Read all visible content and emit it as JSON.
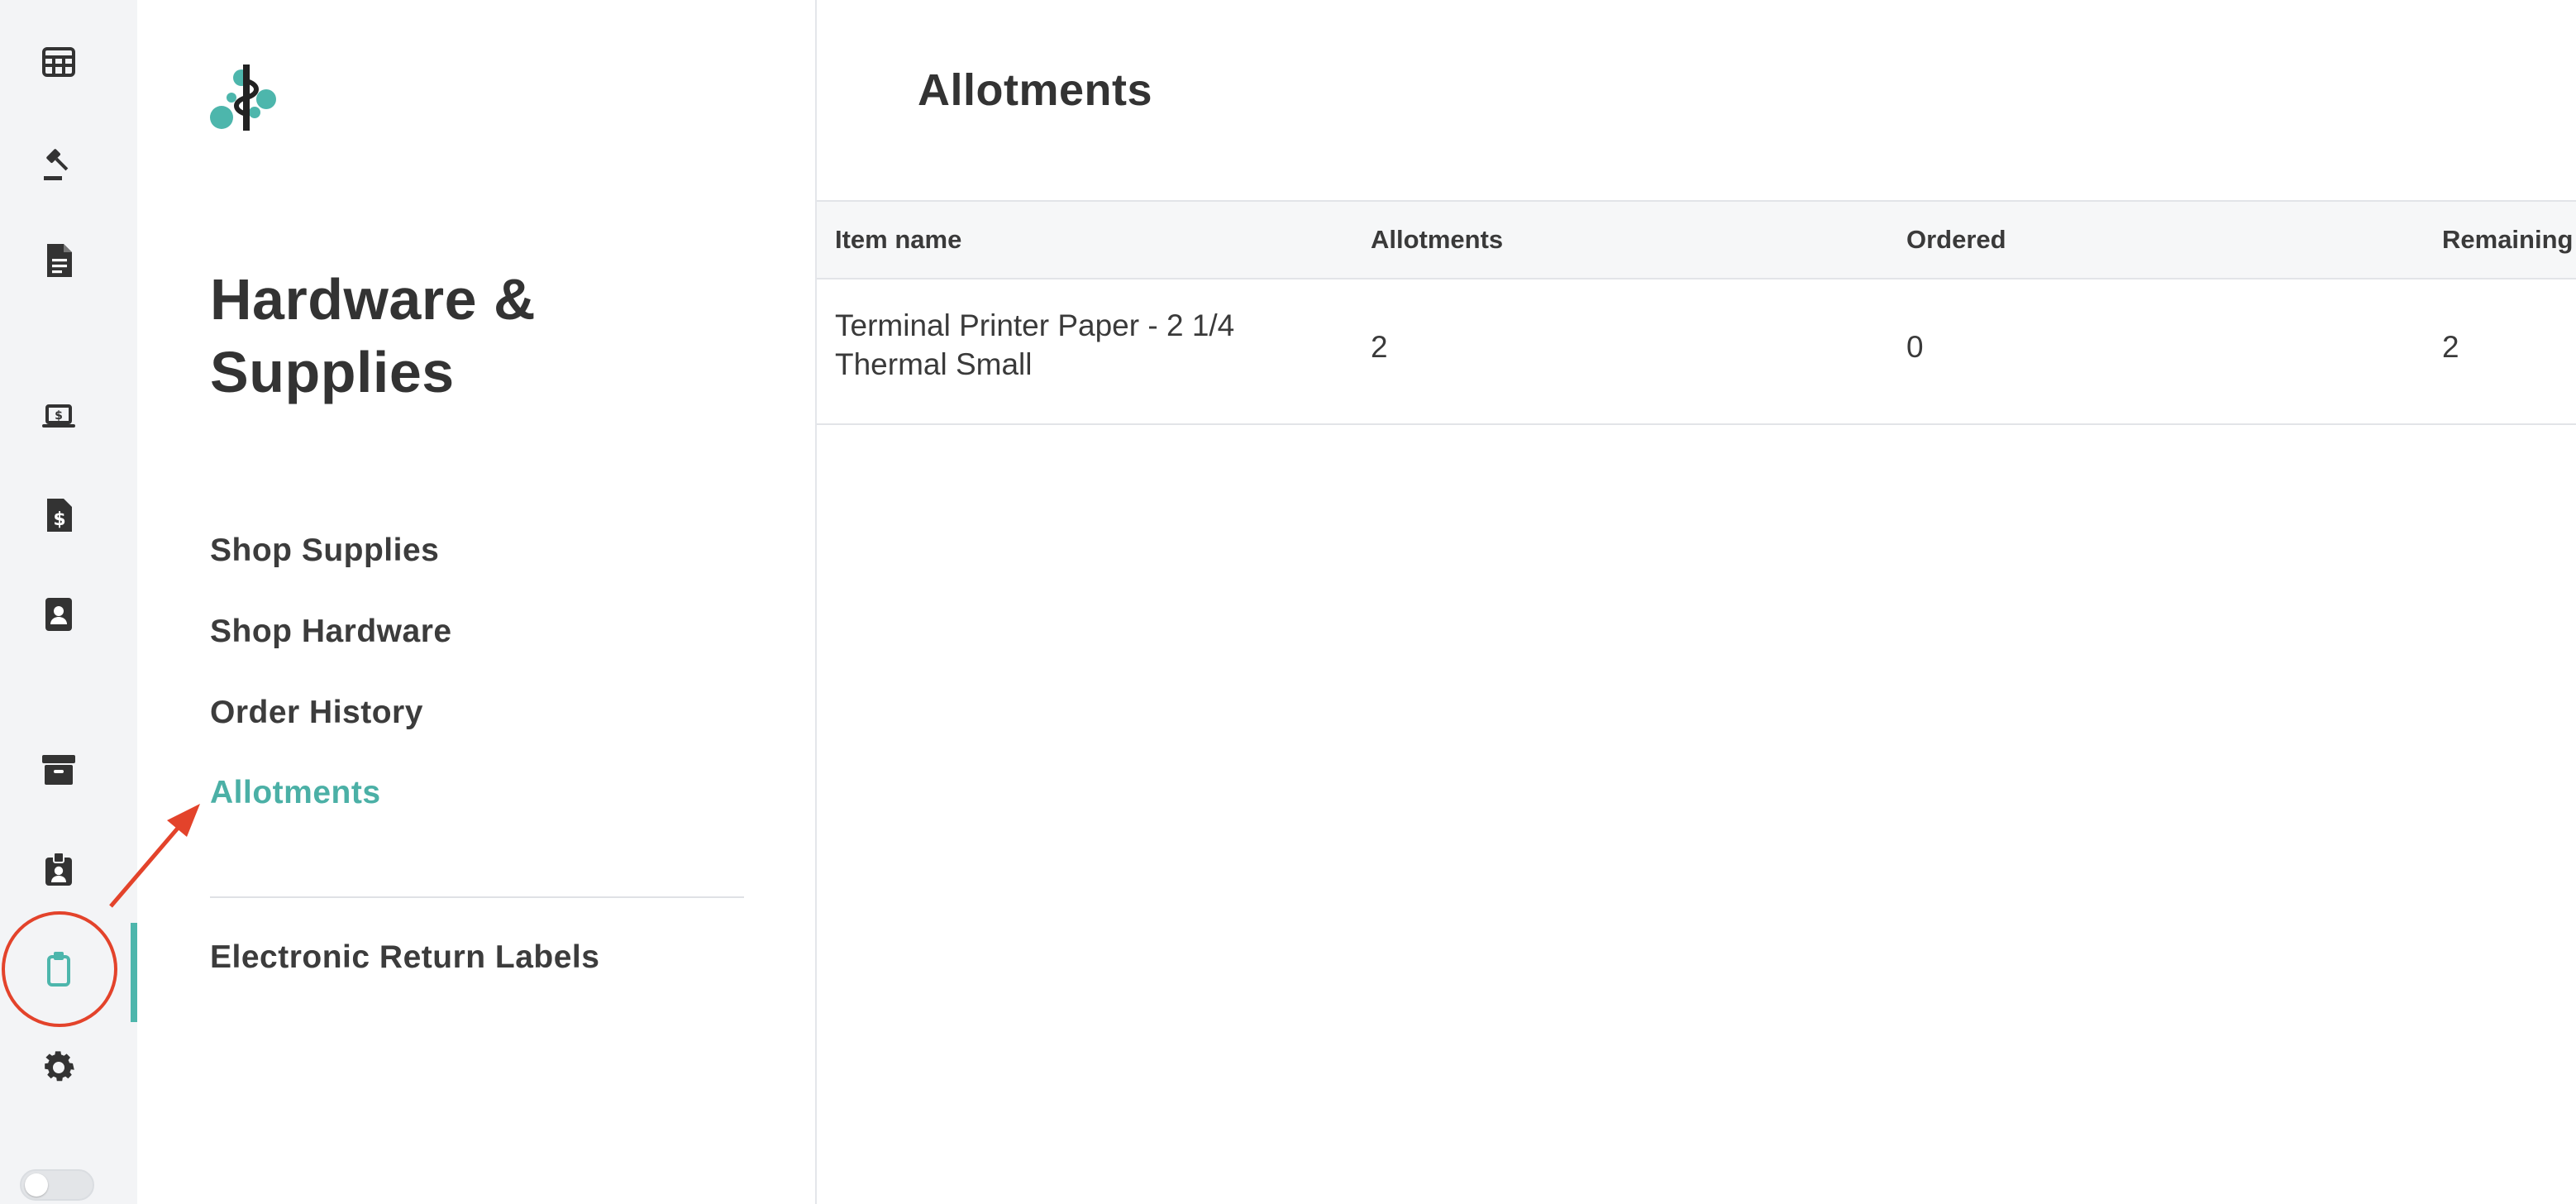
{
  "rail": {
    "items": [
      {
        "icon": "table-icon"
      },
      {
        "icon": "gavel-icon"
      },
      {
        "icon": "document-icon"
      },
      {
        "icon": "laptop-dollar-icon"
      },
      {
        "icon": "invoice-dollar-icon"
      },
      {
        "icon": "contact-book-icon"
      },
      {
        "icon": "archive-box-icon"
      },
      {
        "icon": "id-badge-icon"
      },
      {
        "icon": "clipboard-icon"
      },
      {
        "icon": "gear-icon"
      }
    ],
    "active_item": "clipboard-icon",
    "accent_color": "#4db6ac"
  },
  "subnav": {
    "title": "Hardware & Supplies",
    "links": [
      {
        "label": "Shop Supplies"
      },
      {
        "label": "Shop Hardware"
      },
      {
        "label": "Order History"
      },
      {
        "label": "Allotments"
      }
    ],
    "active_link": "Allotments",
    "secondary_links": [
      {
        "label": "Electronic Return Labels"
      }
    ]
  },
  "main": {
    "title": "Allotments",
    "table": {
      "columns": [
        "Item name",
        "Allotments",
        "Ordered",
        "Remaining"
      ],
      "rows": [
        {
          "item_name": "Terminal Printer Paper - 2 1/4 Thermal Small",
          "allotments": "2",
          "ordered": "0",
          "remaining": "2"
        }
      ]
    }
  },
  "annotation": {
    "color": "#e3432b"
  }
}
